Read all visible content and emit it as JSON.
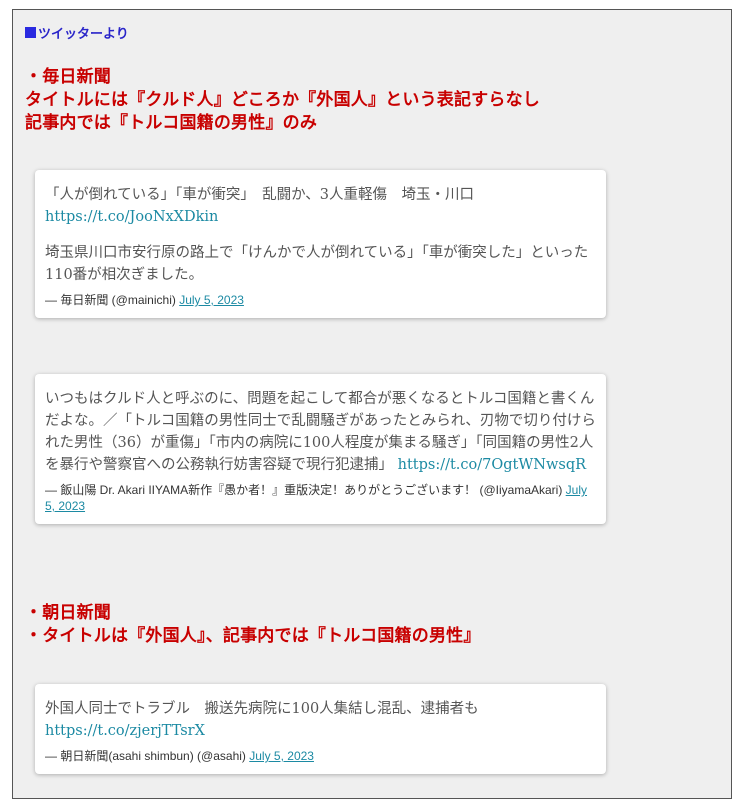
{
  "source_label": "ツイッターより",
  "section1": {
    "lines": [
      "・毎日新聞",
      "タイトルには『クルド人』どころか『外国人』という表記すらなし",
      "記事内では『トルコ国籍の男性』のみ"
    ]
  },
  "tweet1": {
    "headline": "「人が倒れている」「車が衝突」　乱闘か、3人重軽傷　埼玉・川口",
    "link": "https://t.co/JooNxXDkin",
    "body": "埼玉県川口市安行原の路上で「けんかで人が倒れている」「車が衝突した」といった110番が相次ぎました。",
    "author": "— 毎日新聞 (@mainichi)",
    "date": "July 5, 2023"
  },
  "tweet2": {
    "body": "いつもはクルド人と呼ぶのに、問題を起こして都合が悪くなるとトルコ国籍と書くんだよな。／「トルコ国籍の男性同士で乱闘騒ぎがあったとみられ、刃物で切り付けられた男性（36）が重傷」「市内の病院に100人程度が集まる騒ぎ」「同国籍の男性2人を暴行や警察官への公務執行妨害容疑で現行犯逮捕」",
    "link": "https://t.co/7OgtWNwsqR",
    "author": "— 飯山陽 Dr. Akari IIYAMA新作『愚か者！』重版決定！ありがとうございます！ (@IiyamaAkari)",
    "date": "July 5, 2023"
  },
  "section2": {
    "lines": [
      "・朝日新聞",
      "・タイトルは『外国人』、記事内では『トルコ国籍の男性』"
    ]
  },
  "tweet3": {
    "headline": "外国人同士でトラブル　搬送先病院に100人集結し混乱、逮捕者も",
    "link": "https://t.co/zjerjTTsrX",
    "author": "— 朝日新聞(asahi shimbun) (@asahi)",
    "date": "July 5, 2023"
  }
}
